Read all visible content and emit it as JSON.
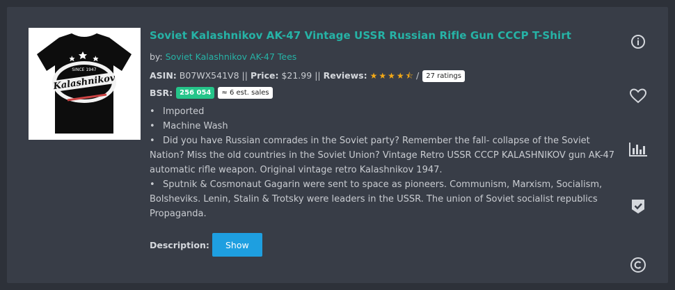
{
  "product": {
    "title": "Soviet Kalashnikov AK-47 Vintage USSR Russian Rifle Gun CCCP T-Shirt",
    "by_label": "by:",
    "brand": "Soviet Kalashnikov AK-47 Tees",
    "asin_label": "ASIN:",
    "asin": "B07WX541V8",
    "sep1": "||",
    "price_label": "Price:",
    "price": "$21.99",
    "sep2": "||",
    "reviews_label": "Reviews:",
    "rating_stars": 4.5,
    "stars_display": "★★★★⯪",
    "slash": "/",
    "ratings_count": "27 ratings",
    "bsr_label": "BSR:",
    "bsr_value": "256 054",
    "est_sales": "≈ 6 est. sales",
    "bullets": [
      "Imported",
      "Machine Wash",
      "Did you have Russian comrades in the Soviet party? Remember the fall- collapse of the Soviet Nation? Miss the old countries in the Soviet Union? Vintage Retro USSR CCCP KALASHNIKOV gun AK-47 automatic rifle weapon. Original vintage retro Kalashnikov 1947.",
      "Sputnik & Cosmonaut Gagarin were sent to space as pioneers. Communism, Marxism, Socialism, Bolsheviks. Lenin, Stalin & Trotsky were leaders in the USSR. The union of Soviet socialist republics Propaganda."
    ],
    "description_label": "Description:",
    "show_button": "Show",
    "shirt_text": {
      "since": "SINCE 1947",
      "logo": "Kalashnikov"
    }
  },
  "side_icons": [
    "info-icon",
    "heart-icon",
    "bar-chart-icon",
    "shield-check-icon",
    "copyright-icon"
  ],
  "colors": {
    "background": "#2d3139",
    "card": "#383d47",
    "accent": "#26b3a6",
    "star": "#f3a917",
    "bsr_badge": "#25c58a",
    "button": "#1e9fe0"
  }
}
